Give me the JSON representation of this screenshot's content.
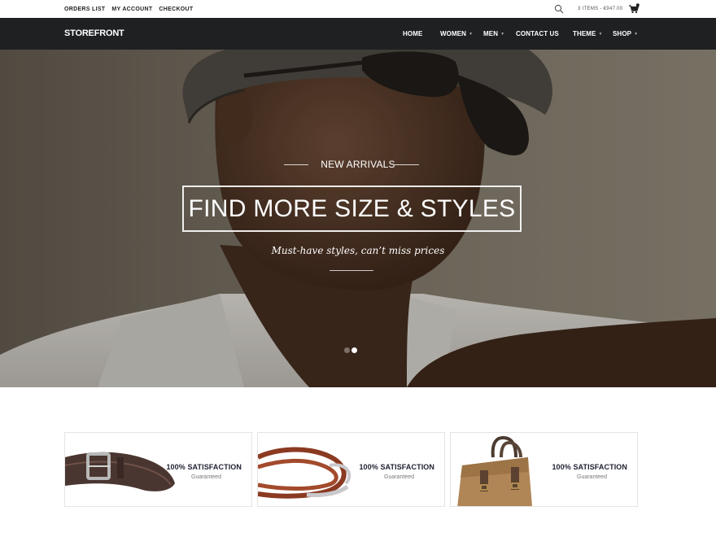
{
  "topbar": {
    "links": [
      "ORDERS LIST",
      "MY ACCOUNT",
      "CHECKOUT"
    ],
    "cart_summary": "3 ITEMS - €947.00",
    "cart_count": "3"
  },
  "nav": {
    "logo": "STOREFRONT",
    "items": [
      {
        "label": "HOME",
        "has_dropdown": false
      },
      {
        "label": "WOMEN",
        "has_dropdown": true
      },
      {
        "label": "MEN",
        "has_dropdown": true
      },
      {
        "label": "CONTACT US",
        "has_dropdown": false
      },
      {
        "label": "THEME",
        "has_dropdown": true
      },
      {
        "label": "SHOP",
        "has_dropdown": true
      }
    ]
  },
  "hero": {
    "eyebrow": "NEW ARRIVALS",
    "headline": "FIND MORE SIZE & STYLES",
    "tagline": "Must-have styles, can’t miss prices",
    "slides_total": 2,
    "active_slide": 2
  },
  "promos": [
    {
      "title": "100% SATISFACTION",
      "subtitle": "Guaranteed",
      "image": "leather-belt"
    },
    {
      "title": "100% SATISFACTION",
      "subtitle": "Guaranteed",
      "image": "leather-bracelet"
    },
    {
      "title": "100% SATISFACTION",
      "subtitle": "Guaranteed",
      "image": "canvas-bag"
    }
  ],
  "colors": {
    "nav_bg": "#1f2022",
    "accent_text": "#1e2030"
  }
}
